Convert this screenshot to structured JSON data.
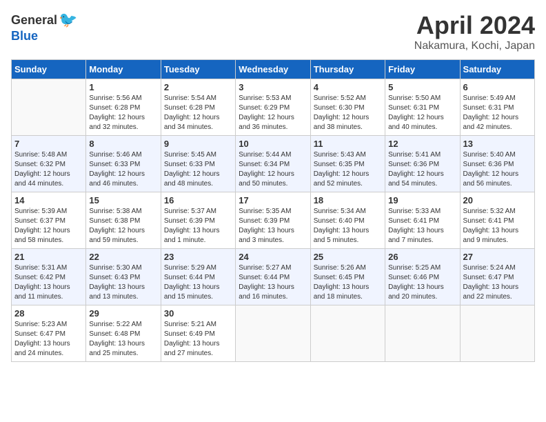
{
  "logo": {
    "general": "General",
    "blue": "Blue"
  },
  "title": "April 2024",
  "subtitle": "Nakamura, Kochi, Japan",
  "days_of_week": [
    "Sunday",
    "Monday",
    "Tuesday",
    "Wednesday",
    "Thursday",
    "Friday",
    "Saturday"
  ],
  "weeks": [
    [
      {
        "day": "",
        "info": ""
      },
      {
        "day": "1",
        "info": "Sunrise: 5:56 AM\nSunset: 6:28 PM\nDaylight: 12 hours\nand 32 minutes."
      },
      {
        "day": "2",
        "info": "Sunrise: 5:54 AM\nSunset: 6:28 PM\nDaylight: 12 hours\nand 34 minutes."
      },
      {
        "day": "3",
        "info": "Sunrise: 5:53 AM\nSunset: 6:29 PM\nDaylight: 12 hours\nand 36 minutes."
      },
      {
        "day": "4",
        "info": "Sunrise: 5:52 AM\nSunset: 6:30 PM\nDaylight: 12 hours\nand 38 minutes."
      },
      {
        "day": "5",
        "info": "Sunrise: 5:50 AM\nSunset: 6:31 PM\nDaylight: 12 hours\nand 40 minutes."
      },
      {
        "day": "6",
        "info": "Sunrise: 5:49 AM\nSunset: 6:31 PM\nDaylight: 12 hours\nand 42 minutes."
      }
    ],
    [
      {
        "day": "7",
        "info": "Sunrise: 5:48 AM\nSunset: 6:32 PM\nDaylight: 12 hours\nand 44 minutes."
      },
      {
        "day": "8",
        "info": "Sunrise: 5:46 AM\nSunset: 6:33 PM\nDaylight: 12 hours\nand 46 minutes."
      },
      {
        "day": "9",
        "info": "Sunrise: 5:45 AM\nSunset: 6:33 PM\nDaylight: 12 hours\nand 48 minutes."
      },
      {
        "day": "10",
        "info": "Sunrise: 5:44 AM\nSunset: 6:34 PM\nDaylight: 12 hours\nand 50 minutes."
      },
      {
        "day": "11",
        "info": "Sunrise: 5:43 AM\nSunset: 6:35 PM\nDaylight: 12 hours\nand 52 minutes."
      },
      {
        "day": "12",
        "info": "Sunrise: 5:41 AM\nSunset: 6:36 PM\nDaylight: 12 hours\nand 54 minutes."
      },
      {
        "day": "13",
        "info": "Sunrise: 5:40 AM\nSunset: 6:36 PM\nDaylight: 12 hours\nand 56 minutes."
      }
    ],
    [
      {
        "day": "14",
        "info": "Sunrise: 5:39 AM\nSunset: 6:37 PM\nDaylight: 12 hours\nand 58 minutes."
      },
      {
        "day": "15",
        "info": "Sunrise: 5:38 AM\nSunset: 6:38 PM\nDaylight: 12 hours\nand 59 minutes."
      },
      {
        "day": "16",
        "info": "Sunrise: 5:37 AM\nSunset: 6:39 PM\nDaylight: 13 hours\nand 1 minute."
      },
      {
        "day": "17",
        "info": "Sunrise: 5:35 AM\nSunset: 6:39 PM\nDaylight: 13 hours\nand 3 minutes."
      },
      {
        "day": "18",
        "info": "Sunrise: 5:34 AM\nSunset: 6:40 PM\nDaylight: 13 hours\nand 5 minutes."
      },
      {
        "day": "19",
        "info": "Sunrise: 5:33 AM\nSunset: 6:41 PM\nDaylight: 13 hours\nand 7 minutes."
      },
      {
        "day": "20",
        "info": "Sunrise: 5:32 AM\nSunset: 6:41 PM\nDaylight: 13 hours\nand 9 minutes."
      }
    ],
    [
      {
        "day": "21",
        "info": "Sunrise: 5:31 AM\nSunset: 6:42 PM\nDaylight: 13 hours\nand 11 minutes."
      },
      {
        "day": "22",
        "info": "Sunrise: 5:30 AM\nSunset: 6:43 PM\nDaylight: 13 hours\nand 13 minutes."
      },
      {
        "day": "23",
        "info": "Sunrise: 5:29 AM\nSunset: 6:44 PM\nDaylight: 13 hours\nand 15 minutes."
      },
      {
        "day": "24",
        "info": "Sunrise: 5:27 AM\nSunset: 6:44 PM\nDaylight: 13 hours\nand 16 minutes."
      },
      {
        "day": "25",
        "info": "Sunrise: 5:26 AM\nSunset: 6:45 PM\nDaylight: 13 hours\nand 18 minutes."
      },
      {
        "day": "26",
        "info": "Sunrise: 5:25 AM\nSunset: 6:46 PM\nDaylight: 13 hours\nand 20 minutes."
      },
      {
        "day": "27",
        "info": "Sunrise: 5:24 AM\nSunset: 6:47 PM\nDaylight: 13 hours\nand 22 minutes."
      }
    ],
    [
      {
        "day": "28",
        "info": "Sunrise: 5:23 AM\nSunset: 6:47 PM\nDaylight: 13 hours\nand 24 minutes."
      },
      {
        "day": "29",
        "info": "Sunrise: 5:22 AM\nSunset: 6:48 PM\nDaylight: 13 hours\nand 25 minutes."
      },
      {
        "day": "30",
        "info": "Sunrise: 5:21 AM\nSunset: 6:49 PM\nDaylight: 13 hours\nand 27 minutes."
      },
      {
        "day": "",
        "info": ""
      },
      {
        "day": "",
        "info": ""
      },
      {
        "day": "",
        "info": ""
      },
      {
        "day": "",
        "info": ""
      }
    ]
  ]
}
